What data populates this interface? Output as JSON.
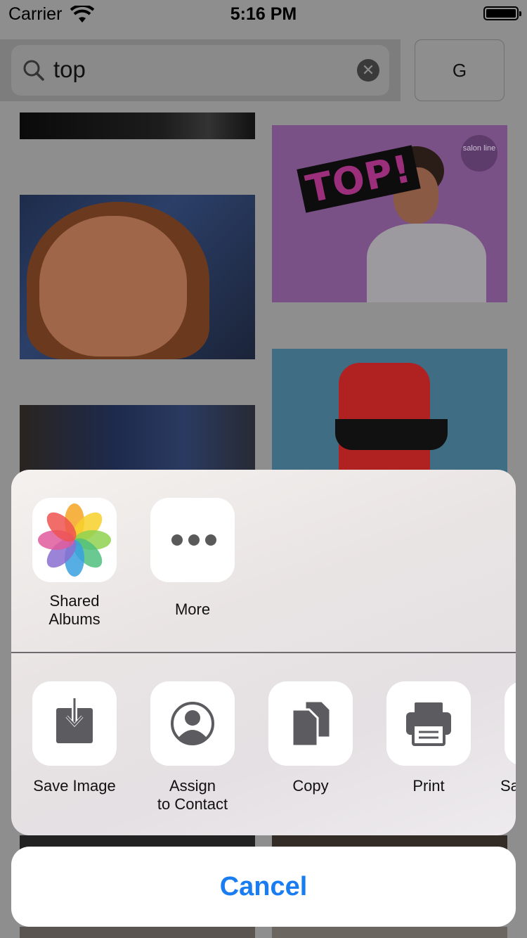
{
  "status_bar": {
    "carrier": "Carrier",
    "time": "5:16 PM"
  },
  "search": {
    "query": "top",
    "side_button": "G"
  },
  "tiles": {
    "top_gif_text": "TOP!",
    "salon_badge": "salon line"
  },
  "share_sheet": {
    "apps": [
      {
        "label": "Shared\nAlbums",
        "icon": "photos-icon"
      },
      {
        "label": "More",
        "icon": "more-dots-icon"
      }
    ],
    "actions": [
      {
        "label": "Save Image",
        "icon": "save-image-icon"
      },
      {
        "label": "Assign\nto Contact",
        "icon": "contact-icon"
      },
      {
        "label": "Copy",
        "icon": "copy-icon"
      },
      {
        "label": "Print",
        "icon": "print-icon"
      },
      {
        "label": "Sa",
        "icon": "partial-action-icon"
      }
    ],
    "cancel_label": "Cancel"
  },
  "colors": {
    "accent": "#1a7cf1",
    "icon_gray": "#5c5c60"
  }
}
